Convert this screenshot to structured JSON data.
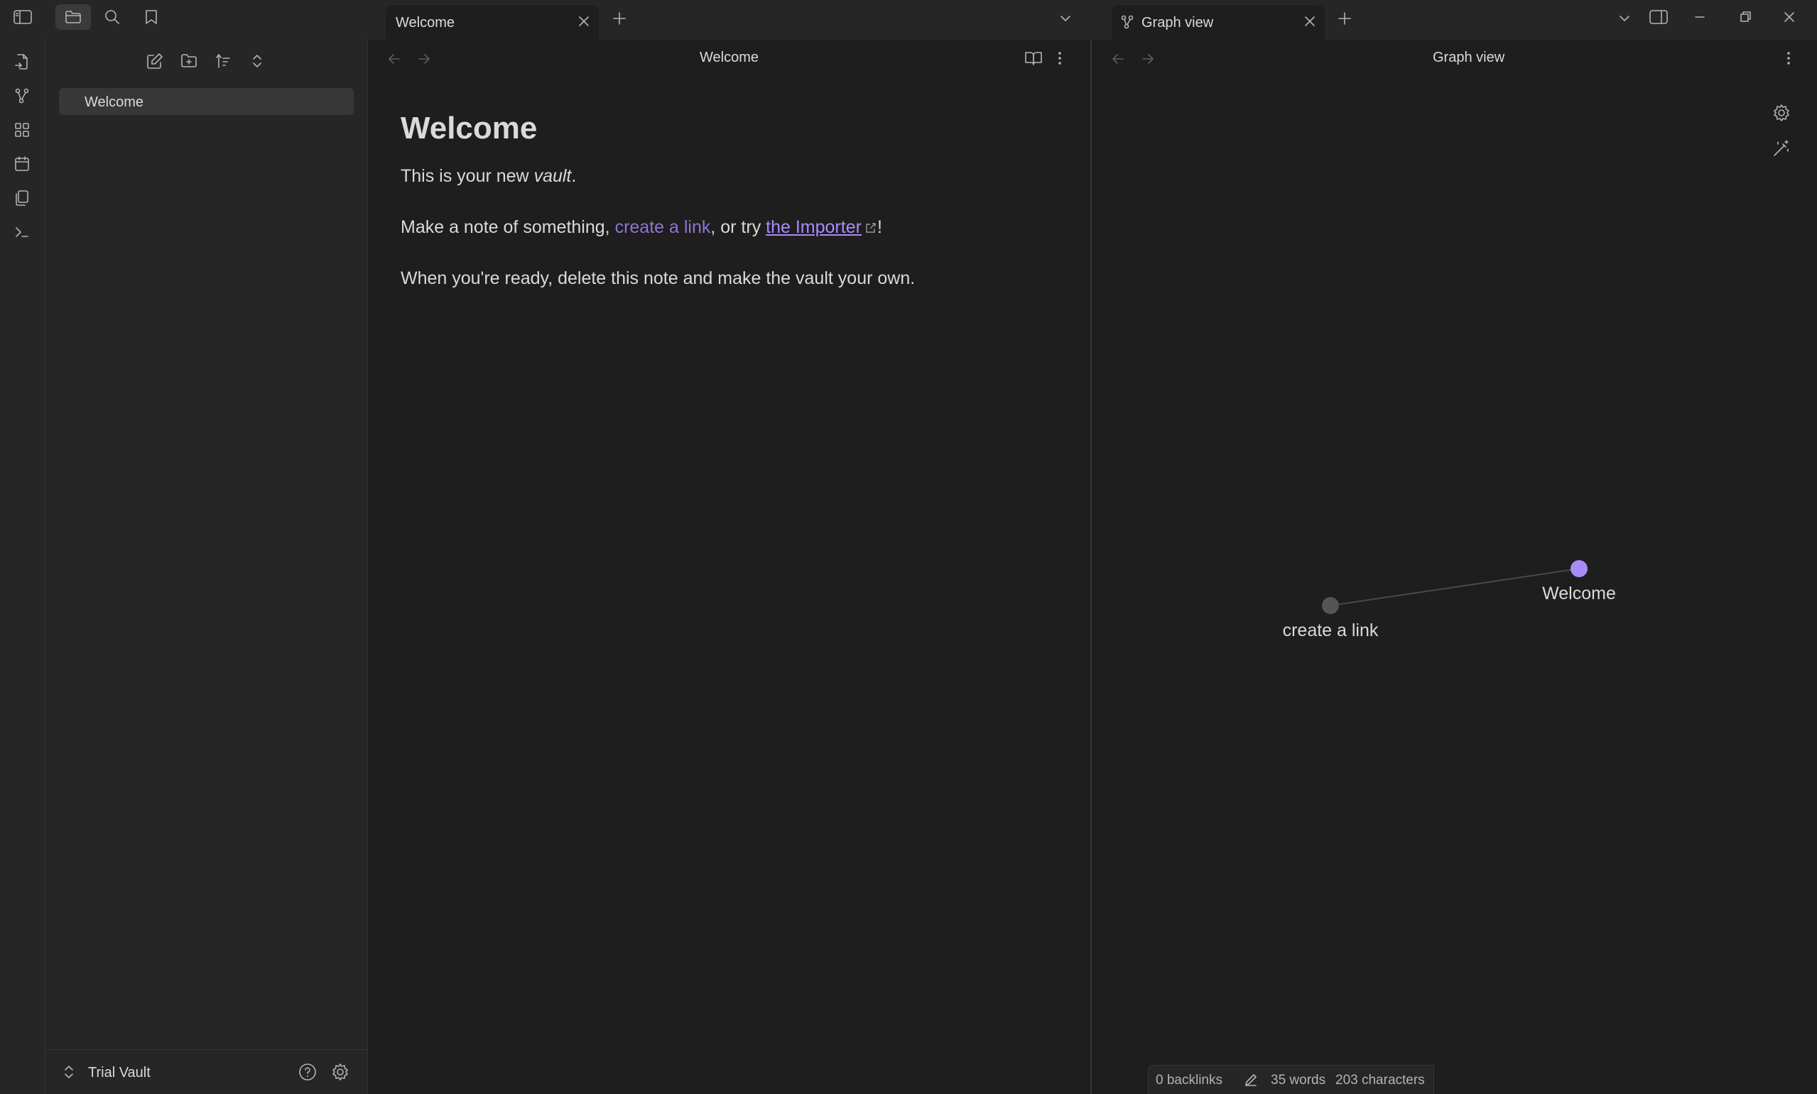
{
  "top_left": {
    "toggle_sidebar_icon": "sidebar-left-icon",
    "files_icon": "folder-icon",
    "search_icon": "search-icon",
    "bookmarks_icon": "bookmark-icon"
  },
  "tabs_left": [
    {
      "title": "Welcome"
    }
  ],
  "tabs_right": [
    {
      "title": "Graph view"
    }
  ],
  "ribbon": {
    "items": [
      "open-quick-switcher-icon",
      "graph-icon",
      "canvas-icon",
      "daily-note-icon",
      "templates-icon",
      "command-palette-icon"
    ]
  },
  "sidebar": {
    "files": [
      {
        "name": "Welcome"
      }
    ],
    "vault_name": "Trial Vault"
  },
  "editor": {
    "header_title": "Welcome",
    "doc": {
      "title": "Welcome",
      "p1_pre": "This is your new ",
      "p1_em": "vault",
      "p1_post": ".",
      "p2_pre": "Make a note of something, ",
      "p2_link1": "create a link",
      "p2_mid": ", or try ",
      "p2_link2": "the Importer",
      "p2_post": "!",
      "p3": "When you're ready, delete this note and make the vault your own."
    }
  },
  "graph": {
    "header_title": "Graph view",
    "nodes": [
      {
        "label": "Welcome",
        "color": "#a88bfa"
      },
      {
        "label": "create a link",
        "color": "#555555"
      }
    ]
  },
  "status": {
    "backlinks": "0 backlinks",
    "words": "35 words",
    "characters": "203 characters"
  },
  "colors": {
    "accent": "#a88bfa",
    "background": "#1e1e1e",
    "chrome": "#262626"
  }
}
